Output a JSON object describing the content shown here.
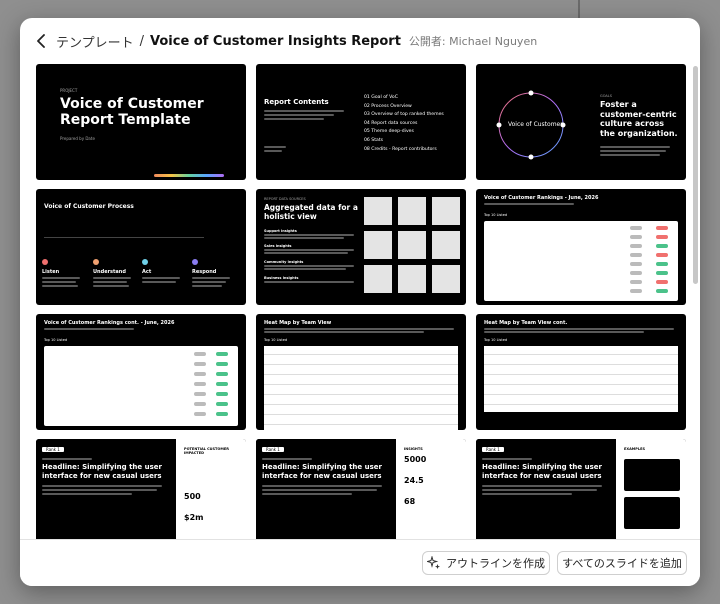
{
  "header": {
    "breadcrumb_parent": "テンプレート",
    "separator": "/",
    "title": "Voice of Customer Insights Report",
    "publisher": "公開者: Michael Nguyen"
  },
  "slides": [
    {
      "title": "Voice of Customer Report Template",
      "eyebrow": "PROJECT",
      "byline": "Prepared by Date"
    },
    {
      "title": "Report Contents",
      "items": [
        "01 Goal of VoC",
        "02 Process Overview",
        "03 Overview of top ranked themes",
        "04 Report data sources",
        "05 Theme deep-dives",
        "06 Stats",
        "08 Credits - Report contributors"
      ]
    },
    {
      "title": "Foster a customer-centric culture across the organization.",
      "center": "Voice of Customer",
      "eyebrow": "GOALS"
    },
    {
      "title": "Voice of Customer Process",
      "steps": [
        "Listen",
        "Understand",
        "Act",
        "Respond"
      ],
      "step_colors": [
        "#f0706e",
        "#f0a070",
        "#6fd0e8",
        "#8a7cf0"
      ]
    },
    {
      "title": "Aggregated data for a holistic view",
      "eyebrow": "REPORT DATA SOURCES",
      "sources": [
        "Support insights",
        "Sales insights",
        "Community insights",
        "Business insights"
      ]
    },
    {
      "title": "Voice of Customer Rankings - June, 2026",
      "subtitle": "Top 10 Listed"
    },
    {
      "title": "Voice of Customer Rankings cont. - June, 2026",
      "subtitle": "Top 10 Listed"
    },
    {
      "title": "Heat Map by Team View",
      "subtitle": "Top 10 Listed"
    },
    {
      "title": "Heat Map by Team View cont.",
      "subtitle": "Top 10 Listed"
    },
    {
      "title": "Headline: Simplifying the user interface for new casual users",
      "tag": "Rank 1",
      "side_title": "POTENTIAL CUSTOMER IMPACTED",
      "stats": [
        "500",
        "$2m"
      ]
    },
    {
      "title": "Headline: Simplifying the user interface for new casual users",
      "tag": "Rank 1",
      "side_title": "INSIGHTS",
      "stats": [
        "5000",
        "24.5",
        "68"
      ]
    },
    {
      "title": "Headline: Simplifying the user interface for new casual users",
      "tag": "Rank 1",
      "side_title": "EXAMPLES"
    }
  ],
  "footer": {
    "outline_button": "アウトラインを作成",
    "add_all_button": "すべてのスライドを追加"
  },
  "colors": {
    "accent_red": "#f0706e",
    "accent_green": "#4bc28a",
    "accent_blue": "#58a6ff"
  }
}
